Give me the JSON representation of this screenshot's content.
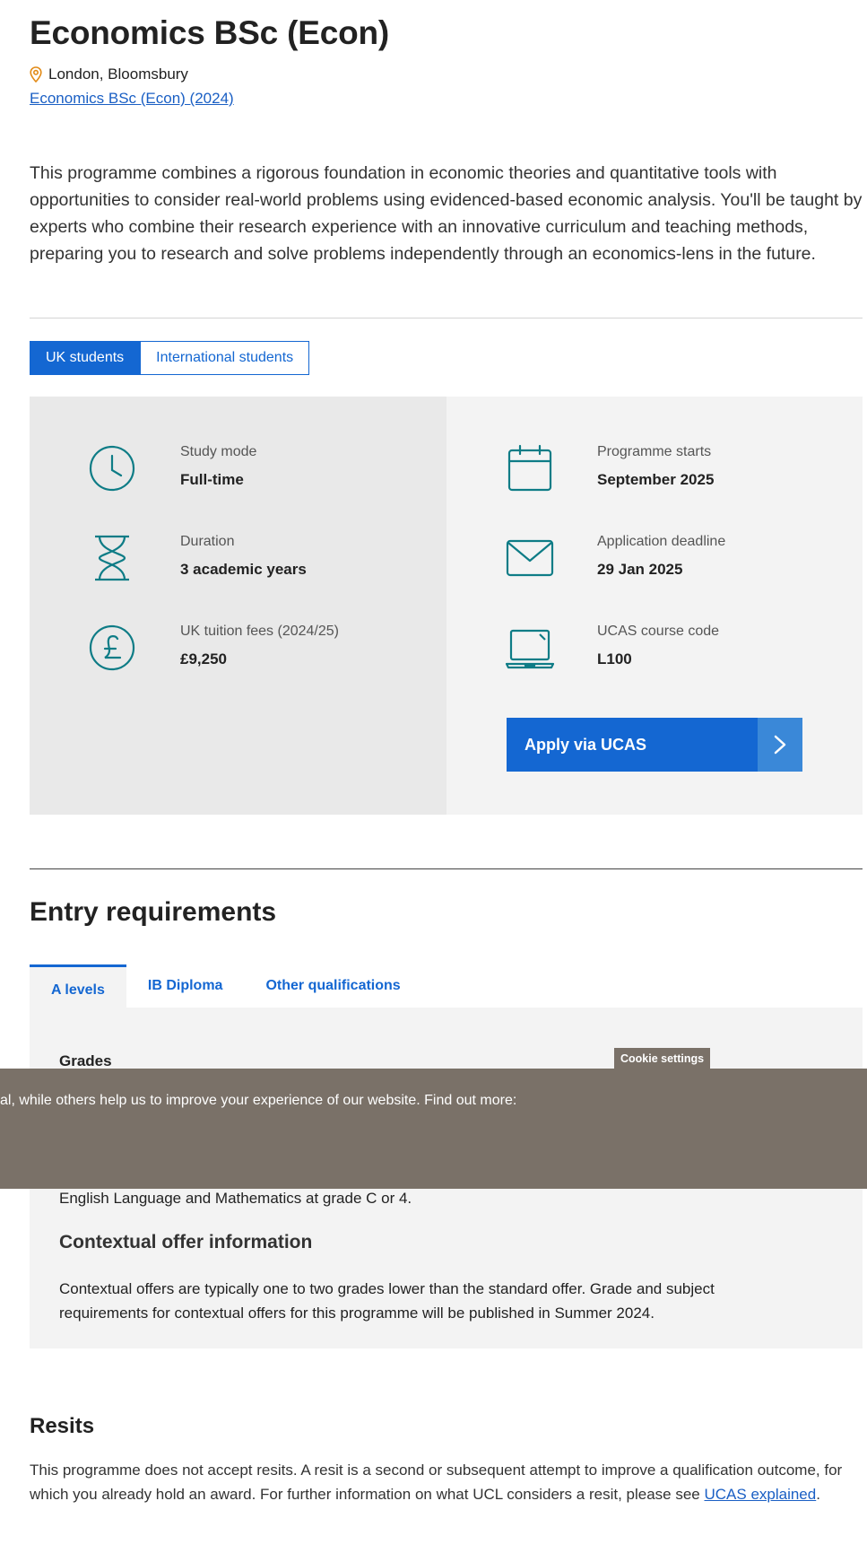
{
  "page_title": "Economics BSc (Econ)",
  "location": {
    "icon": "location-pin-icon",
    "text": "London, Bloomsbury"
  },
  "course_link": "Economics BSc (Econ) (2024)",
  "intro": "This programme combines a rigorous foundation in economic theories and quantitative tools with opportunities to consider real-world problems using evidenced-based economic analysis. You'll be taught by experts who combine their research experience with an innovative curriculum and teaching methods, preparing you to research and solve problems independently through an economics-lens in the future.",
  "student_tabs": [
    "UK students",
    "International students"
  ],
  "active_student_tab": "UK students",
  "key_info": {
    "left": [
      {
        "icon": "clock-icon",
        "label": "Study mode",
        "value": "Full-time"
      },
      {
        "icon": "hourglass-icon",
        "label": "Duration",
        "value": "3 academic years"
      },
      {
        "icon": "pound-icon",
        "label": "UK tuition fees (2024/25)",
        "value": "£9,250"
      }
    ],
    "right": [
      {
        "icon": "calendar-icon",
        "label": "Programme starts",
        "value": "September 2025"
      },
      {
        "icon": "envelope-icon",
        "label": "Application deadline",
        "value": "29 Jan 2025"
      },
      {
        "icon": "laptop-icon",
        "label": "UCAS course code",
        "value": "L100"
      }
    ]
  },
  "apply_button": "Apply via UCAS",
  "entry": {
    "heading": "Entry requirements",
    "tabs": [
      "A levels",
      "IB Diploma",
      "Other qualifications"
    ],
    "active_tab": "A levels",
    "grades_heading": "Grades",
    "english_text": "English Language and Mathematics at grade C or 4.",
    "contextual_heading": "Contextual offer information",
    "contextual_text": "Contextual offers are typically one to two grades lower than the standard offer. Grade and subject requirements for contextual offers for this programme will be published in Summer 2024."
  },
  "resits": {
    "heading": "Resits",
    "text": "This programme does not accept resits. A resit is a second or subsequent attempt to improve a qualification outcome, for which you already hold an award. For further information on what UCL considers a resit, please see ",
    "link": "UCAS explained",
    "suffix": "."
  },
  "cookie": {
    "tab_label": "Cookie settings",
    "banner_text": "al, while others help us to improve your experience of our website. Find out more:"
  },
  "colors": {
    "primary": "#1467d2",
    "icon_teal": "#0e7c86",
    "cookie_bg": "#7a7168"
  }
}
